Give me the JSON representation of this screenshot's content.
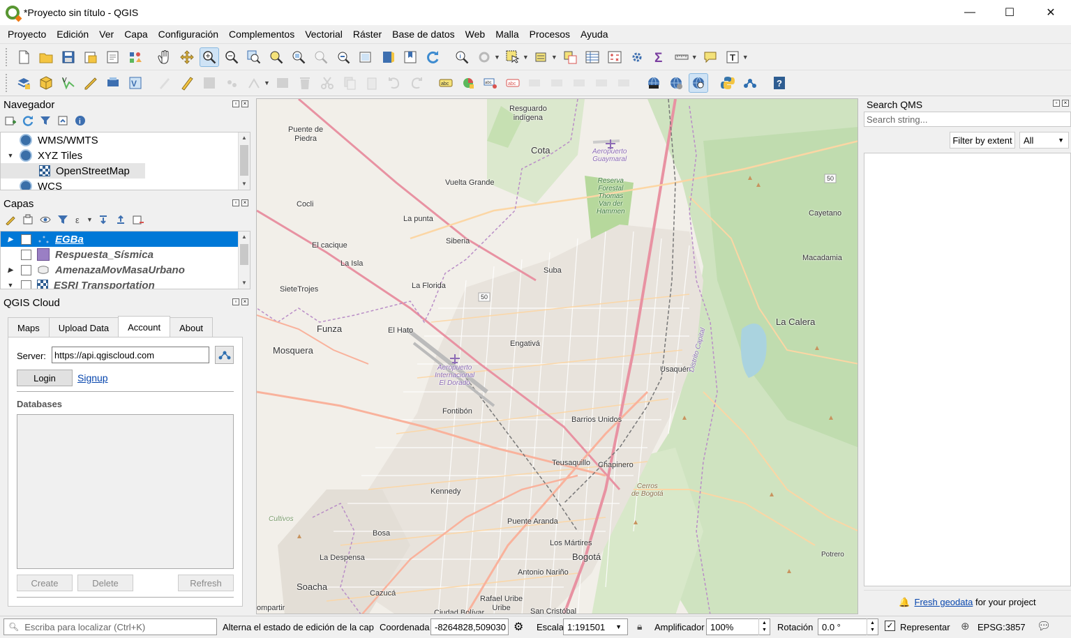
{
  "window": {
    "title": "*Proyecto sin título - QGIS",
    "minimize": "—",
    "maximize": "☐",
    "close": "✕"
  },
  "menu": [
    "Proyecto",
    "Edición",
    "Ver",
    "Capa",
    "Configuración",
    "Complementos",
    "Vectorial",
    "Ráster",
    "Base de datos",
    "Web",
    "Malla",
    "Procesos",
    "Ayuda"
  ],
  "navigator": {
    "title": "Navegador",
    "items": [
      {
        "label": "WMS/WMTS",
        "icon": "globe-icon"
      },
      {
        "label": "XYZ Tiles",
        "icon": "globe-icon",
        "expanded": true
      },
      {
        "label": "OpenStreetMap",
        "icon": "xyz-tile-icon"
      },
      {
        "label": "WCS",
        "icon": "globe-icon"
      }
    ]
  },
  "layers": {
    "title": "Capas",
    "items": [
      {
        "label": "EGBa",
        "selected": true,
        "icon": "point-layer-icon"
      },
      {
        "label": "Respuesta_Sísmica",
        "icon": "polygon-layer-icon",
        "color": "#9a7fc4"
      },
      {
        "label": "AmenazaMovMasaUrbano",
        "icon": "polygon-layer-icon"
      },
      {
        "label": "ESRI Transportation",
        "icon": "xyz-tile-icon"
      }
    ]
  },
  "cloud": {
    "title": "QGIS Cloud",
    "tabs": [
      "Maps",
      "Upload Data",
      "Account",
      "About"
    ],
    "active_tab": "Account",
    "server_label": "Server:",
    "server_value": "https://api.qgiscloud.com",
    "login_label": "Login",
    "signup_label": "Signup",
    "databases_label": "Databases",
    "create_label": "Create",
    "delete_label": "Delete",
    "refresh_label": "Refresh"
  },
  "map": {
    "labels": {
      "resguardo": "Resguardo\nindígena",
      "puente_piedra": "Puente de\nPiedra",
      "cota": "Cota",
      "aeropuerto_guaymaral": "Aeropuerto\nGuaymaral",
      "reserva": "Reserva\nForestal\nThomas\nVan der\nHammen",
      "vuelta_grande": "Vuelta Grande",
      "cocli": "Cocli",
      "la_punta": "La punta",
      "siberia": "Siberia",
      "el_cacique": "El cacique",
      "la_isla": "La Isla",
      "suba": "Suba",
      "sietetrojes": "SieteTrojes",
      "la_florida": "La Florida",
      "cayetano": "Cayetano",
      "macadamia": "Macadamia",
      "la_calera": "La Calera",
      "funza": "Funza",
      "el_hato": "El Hato",
      "mosquera": "Mosquera",
      "engativa": "Engativá",
      "aeropuerto_dorado": "Aeropuerto\nInternacional\nEl Dorado",
      "usaquen": "Usaquén",
      "distrito_capital": "Distrito Capital",
      "fontibon": "Fontibón",
      "barrios_unidos": "Barrios Unidos",
      "teusaquillo": "Teusaquillo",
      "chapinero": "Chapinero",
      "cerros": "Cerros\nde Bogotá",
      "cultivos": "Cultivos",
      "kennedy": "Kennedy",
      "puente_aranda": "Puente Aranda",
      "bosa": "Bosa",
      "los_martires": "Los Mártires",
      "bogota": "Bogotá",
      "la_despensa": "La Despensa",
      "antonio_narino": "Antonio Nariño",
      "potrero": "Potrero",
      "soacha": "Soacha",
      "cazuca": "Cazucá",
      "rafael_uribe": "Rafael Uribe\nUribe",
      "san_cristobal": "San Cristóbal",
      "ciudad_bolivar": "Ciudad Bolívar",
      "compartir": "ompartir",
      "road_50a": "50",
      "road_50b": "50"
    }
  },
  "qms": {
    "title": "Search QMS",
    "search_placeholder": "Search string...",
    "filter_label": "Filter by extent",
    "select_value": "All",
    "footer_link": "Fresh geodata",
    "footer_text": " for your project"
  },
  "status": {
    "locator_placeholder": "Escriba para localizar (Ctrl+K)",
    "message": "Alterna el estado de edición de la cap",
    "coord_label": "Coordenada",
    "coord_value": "-8264828,509030",
    "scale_label": "Escala",
    "scale_value": "1:191501",
    "magnifier_label": "Amplificador",
    "magnifier_value": "100%",
    "rotation_label": "Rotación",
    "rotation_value": "0.0 °",
    "render_label": "Representar",
    "crs_label": "EPSG:3857"
  }
}
